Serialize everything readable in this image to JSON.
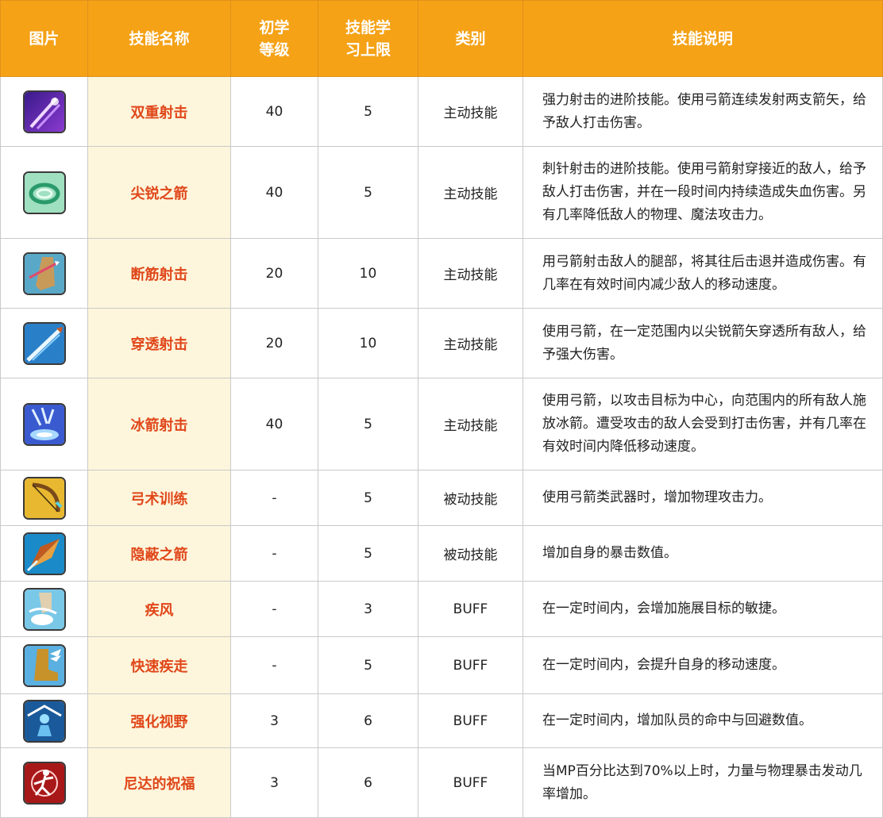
{
  "table": {
    "headers": {
      "image": "图片",
      "name": "技能名称",
      "level_line1": "初学",
      "level_line2": "等级",
      "max_line1": "技能学",
      "max_line2": "习上限",
      "category": "类别",
      "description": "技能说明"
    },
    "rows": [
      {
        "icon": "purple-streak-icon",
        "name": "双重射击",
        "level": "40",
        "max": "5",
        "category": "主动技能",
        "description": "强力射击的进阶技能。使用弓箭连续发射两支箭矢，给予敌人打击伤害。"
      },
      {
        "icon": "green-swirl-icon",
        "name": "尖锐之箭",
        "level": "40",
        "max": "5",
        "category": "主动技能",
        "description": "刺针射击的进阶技能。使用弓箭射穿接近的敌人，给予敌人打击伤害，并在一段时间内持续造成失血伤害。另有几率降低敌人的物理、魔法攻击力。"
      },
      {
        "icon": "leg-arrow-icon",
        "name": "断筋射击",
        "level": "20",
        "max": "10",
        "category": "主动技能",
        "description": "用弓箭射击敌人的腿部，将其往后击退并造成伤害。有几率在有效时间内减少敌人的移动速度。"
      },
      {
        "icon": "piercing-arrow-icon",
        "name": "穿透射击",
        "level": "20",
        "max": "10",
        "category": "主动技能",
        "description": "使用弓箭，在一定范围内以尖锐箭矢穿透所有敌人，给予强大伤害。"
      },
      {
        "icon": "ice-arrow-icon",
        "name": "冰箭射击",
        "level": "40",
        "max": "5",
        "category": "主动技能",
        "description": "使用弓箭，以攻击目标为中心，向范围内的所有敌人施放冰箭。遭受攻击的敌人会受到打击伤害，并有几率在有效时间内降低移动速度。"
      },
      {
        "icon": "bow-icon",
        "name": "弓术训练",
        "level": "-",
        "max": "5",
        "category": "被动技能",
        "description": "使用弓箭类武器时，增加物理攻击力。"
      },
      {
        "icon": "arrowhead-icon",
        "name": "隐蔽之箭",
        "level": "-",
        "max": "5",
        "category": "被动技能",
        "description": "增加自身的暴击数值。"
      },
      {
        "icon": "wind-boot-icon",
        "name": "疾风",
        "level": "-",
        "max": "3",
        "category": "BUFF",
        "description": "在一定时间内，会增加施展目标的敏捷。"
      },
      {
        "icon": "winged-boot-icon",
        "name": "快速疾走",
        "level": "-",
        "max": "5",
        "category": "BUFF",
        "description": "在一定时间内，会提升自身的移动速度。"
      },
      {
        "icon": "vision-icon",
        "name": "强化视野",
        "level": "3",
        "max": "6",
        "category": "BUFF",
        "description": "在一定时间内，增加队员的命中与回避数值。"
      },
      {
        "icon": "blessing-icon",
        "name": "尼达的祝福",
        "level": "3",
        "max": "6",
        "category": "BUFF",
        "description": "当MP百分比达到70%以上时，力量与物理暴击发动几率增加。"
      }
    ]
  }
}
